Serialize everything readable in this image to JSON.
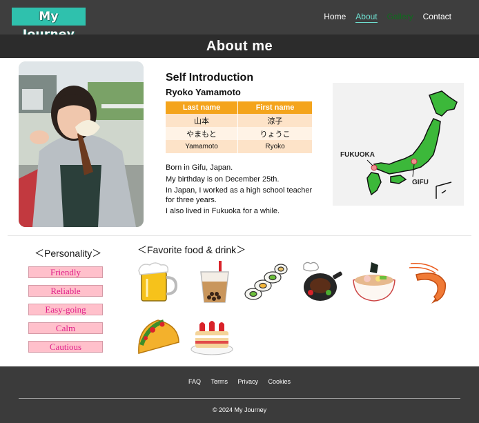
{
  "header": {
    "logo": "My Journey",
    "nav": [
      "Home",
      "About",
      "Gallery",
      "Contact"
    ]
  },
  "title": "About me",
  "intro": {
    "heading": "Self Introduction",
    "name": "Ryoko Yamamoto",
    "table": {
      "headers": [
        "Last name",
        "First name"
      ],
      "rows": [
        [
          "山本",
          "涼子"
        ],
        [
          "やまもと",
          "りょうこ"
        ],
        [
          "Yamamoto",
          "Ryoko"
        ]
      ]
    },
    "bio": [
      "Born in Gifu, Japan.",
      "My birthday is on December 25th.",
      "In Japan, I worked as a high school teacher for three years.",
      "I also lived in Fukuoka for a while."
    ]
  },
  "map": {
    "labels": [
      "FUKUOKA",
      "GIFU"
    ]
  },
  "personality": {
    "title": "＜Personality＞",
    "traits": [
      "Friendly",
      "Reliable",
      "Easy-going",
      "Calm",
      "Cautious"
    ]
  },
  "food": {
    "title": "＜Favorite food & drink＞",
    "items": [
      "beer-icon",
      "bubble-tea-icon",
      "sushi-roll-icon",
      "hamburg-steak-icon",
      "ramen-icon",
      "shrimp-icon",
      "taco-icon",
      "strawberry-cake-icon"
    ]
  },
  "footer": {
    "links": [
      "FAQ",
      "Terms",
      "Privacy",
      "Cookies"
    ],
    "copyright": "© 2024 My Journey"
  },
  "colors": {
    "header_bg": "#3e3e3e",
    "logo_bg": "#2fc1ad",
    "table_header": "#f4a41c",
    "trait_bg": "#ffc0cb",
    "trait_text": "#e0208a",
    "map_land": "#3cb83a"
  }
}
